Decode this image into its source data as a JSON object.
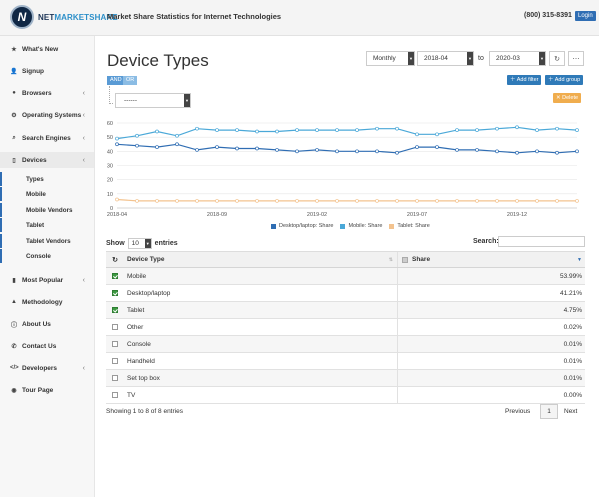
{
  "header": {
    "brand_bold": "NET",
    "brand_light": "MARKETSHARE",
    "title": "Market Share Statistics for Internet Technologies",
    "phone": "(800) 315-8391",
    "login_label": "Login"
  },
  "sidebar": {
    "items": [
      {
        "label": "What's New",
        "icon": "star-icon",
        "glyph": "★"
      },
      {
        "label": "Signup",
        "icon": "user-plus-icon",
        "glyph": "👤"
      },
      {
        "label": "Browsers",
        "icon": "globe-icon",
        "glyph": "●"
      },
      {
        "label": "Operating Systems",
        "icon": "gear-icon",
        "glyph": "⚙"
      },
      {
        "label": "Search Engines",
        "icon": "search-icon",
        "glyph": "⌕"
      },
      {
        "label": "Devices",
        "icon": "tablet-icon",
        "glyph": "▯"
      }
    ],
    "sub_items": [
      "Types",
      "Mobile",
      "Mobile Vendors",
      "Tablet",
      "Tablet Vendors",
      "Console"
    ],
    "bottom_items": [
      {
        "label": "Most Popular",
        "icon": "bar-chart-icon",
        "glyph": "▮"
      },
      {
        "label": "Methodology",
        "icon": "flask-icon",
        "glyph": "▲"
      },
      {
        "label": "About Us",
        "icon": "info-icon",
        "glyph": "ⓘ"
      },
      {
        "label": "Contact Us",
        "icon": "phone-icon",
        "glyph": "✆"
      },
      {
        "label": "Developers",
        "icon": "code-icon",
        "glyph": "</>"
      },
      {
        "label": "Tour Page",
        "icon": "location-icon",
        "glyph": "◉"
      }
    ]
  },
  "main": {
    "title": "Device Types",
    "period": "Monthly",
    "date_from": "2018-04",
    "to_label": "to",
    "date_to": "2020-03",
    "and_label": "AND",
    "or_label": "OR",
    "add_filter_label": "Add filter",
    "add_group_label": "Add group",
    "delete_label": "Delete",
    "filter_placeholder": "------"
  },
  "chart_data": {
    "type": "line",
    "x": [
      "2018-04",
      "2018-05",
      "2018-06",
      "2018-07",
      "2018-08",
      "2018-09",
      "2018-10",
      "2018-11",
      "2018-12",
      "2019-01",
      "2019-02",
      "2019-03",
      "2019-04",
      "2019-05",
      "2019-06",
      "2019-07",
      "2019-08",
      "2019-09",
      "2019-10",
      "2019-11",
      "2019-12",
      "2020-01",
      "2020-02",
      "2020-03"
    ],
    "x_tick_labels": [
      "2018-04",
      "2018-09",
      "2019-02",
      "2019-07",
      "2019-12"
    ],
    "series": [
      {
        "name": "Desktop/laptop: Share",
        "color": "#2f6db3",
        "values": [
          45,
          44,
          43,
          45,
          41,
          43,
          42,
          42,
          41,
          40,
          41,
          40,
          40,
          40,
          39,
          43,
          43,
          41,
          41,
          40,
          39,
          40,
          39,
          40
        ]
      },
      {
        "name": "Mobile: Share",
        "color": "#4aa8d8",
        "values": [
          49,
          51,
          54,
          51,
          56,
          55,
          55,
          54,
          54,
          55,
          55,
          55,
          55,
          56,
          56,
          52,
          52,
          55,
          55,
          56,
          57,
          55,
          56,
          55
        ]
      },
      {
        "name": "Tablet: Share",
        "color": "#f3c38f",
        "values": [
          6,
          5,
          5,
          5,
          5,
          5,
          5,
          5,
          5,
          5,
          5,
          5,
          5,
          5,
          5,
          5,
          5,
          5,
          5,
          5,
          5,
          5,
          5,
          5
        ]
      }
    ],
    "y_ticks": [
      0,
      10,
      20,
      30,
      40,
      50,
      60
    ],
    "ylim": [
      0,
      60
    ],
    "grid": true,
    "legend": "bottom"
  },
  "table": {
    "show_label": "Show",
    "page_length": "10",
    "entries_label": "entries",
    "search_label": "Search:",
    "columns": [
      "Device Type",
      "Share"
    ],
    "rows": [
      {
        "name": "Mobile",
        "share": "53.99%",
        "checked": true
      },
      {
        "name": "Desktop/laptop",
        "share": "41.21%",
        "checked": true
      },
      {
        "name": "Tablet",
        "share": "4.75%",
        "checked": true
      },
      {
        "name": "Other",
        "share": "0.02%",
        "checked": false
      },
      {
        "name": "Console",
        "share": "0.01%",
        "checked": false
      },
      {
        "name": "Handheld",
        "share": "0.01%",
        "checked": false
      },
      {
        "name": "Set top box",
        "share": "0.01%",
        "checked": false
      },
      {
        "name": "TV",
        "share": "0.00%",
        "checked": false
      }
    ],
    "info": "Showing 1 to 8 of 8 entries",
    "prev_label": "Previous",
    "page": "1",
    "next_label": "Next"
  }
}
